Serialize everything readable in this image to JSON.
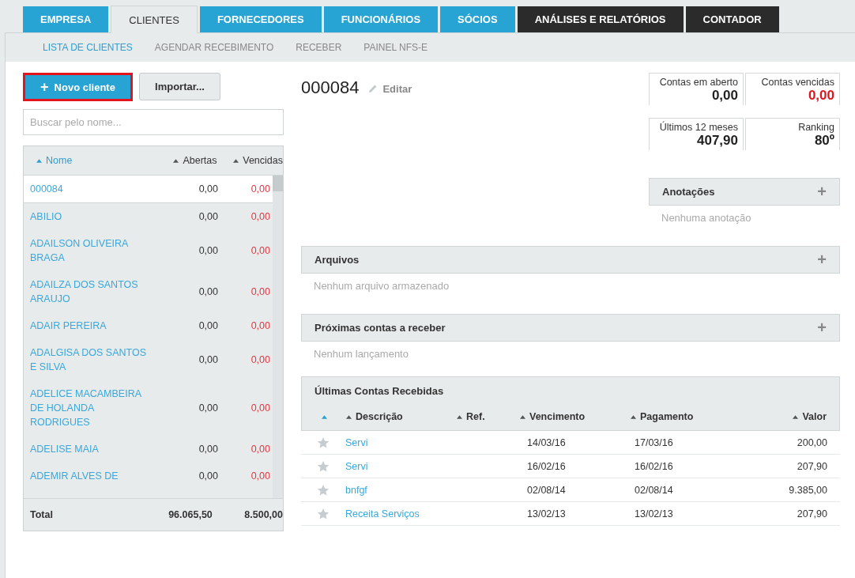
{
  "tabs": [
    {
      "label": "EMPRESA",
      "kind": "module",
      "selected": false
    },
    {
      "label": "CLIENTES",
      "kind": "module",
      "selected": true
    },
    {
      "label": "FORNECEDORES",
      "kind": "module",
      "selected": false
    },
    {
      "label": "FUNCIONÁRIOS",
      "kind": "module",
      "selected": false
    },
    {
      "label": "SÓCIOS",
      "kind": "module",
      "selected": false
    },
    {
      "label": "ANÁLISES E RELATÓRIOS",
      "kind": "report",
      "selected": false
    },
    {
      "label": "CONTADOR",
      "kind": "report",
      "selected": false
    }
  ],
  "subnav": [
    {
      "label": "LISTA DE CLIENTES",
      "selected": true
    },
    {
      "label": "AGENDAR RECEBIMENTO",
      "selected": false
    },
    {
      "label": "RECEBER",
      "selected": false
    },
    {
      "label": "PAINEL NFS-E",
      "selected": false
    }
  ],
  "new_button": {
    "icon": "+",
    "label": "Novo cliente"
  },
  "import_button": "Importar...",
  "search": {
    "placeholder": "Buscar pelo nome..."
  },
  "client_table": {
    "columns": [
      {
        "label": "Nome",
        "selected": true
      },
      {
        "label": "Abertas",
        "selected": false
      },
      {
        "label": "Vencidas",
        "selected": false
      }
    ],
    "rows": [
      {
        "name": "000084",
        "open": "0,00",
        "overdue": "0,00",
        "selected": true
      },
      {
        "name": "ABILIO",
        "open": "0,00",
        "overdue": "0,00",
        "selected": false
      },
      {
        "name": "ADAILSON OLIVEIRA BRAGA",
        "open": "0,00",
        "overdue": "0,00",
        "selected": false
      },
      {
        "name": "ADAILZA DOS SANTOS ARAUJO",
        "open": "0,00",
        "overdue": "0,00",
        "selected": false
      },
      {
        "name": "ADAIR PEREIRA",
        "open": "0,00",
        "overdue": "0,00",
        "selected": false
      },
      {
        "name": "ADALGISA DOS SANTOS E SILVA",
        "open": "0,00",
        "overdue": "0,00",
        "selected": false
      },
      {
        "name": "ADELICE MACAMBEIRA DE HOLANDA RODRIGUES",
        "open": "0,00",
        "overdue": "0,00",
        "selected": false
      },
      {
        "name": "ADELISE MAIA",
        "open": "0,00",
        "overdue": "0,00",
        "selected": false
      },
      {
        "name": "ADEMIR ALVES DE",
        "open": "0,00",
        "overdue": "0,00",
        "selected": false
      }
    ],
    "total": {
      "label": "Total",
      "open": "96.065,50",
      "overdue": "8.500,00"
    }
  },
  "client": {
    "code": "000084",
    "edit": "Editar"
  },
  "stats": [
    {
      "label": "Contas em aberto",
      "value": "0,00",
      "alert": false
    },
    {
      "label": "Contas vencidas",
      "value": "0,00",
      "alert": true
    },
    {
      "label": "Últimos 12 meses",
      "value": "407,90",
      "alert": false
    },
    {
      "label": "Ranking",
      "value": "80º",
      "alert": false
    }
  ],
  "notes": {
    "title": "Anotações",
    "add": "+",
    "empty": "Nenhuma anotação"
  },
  "sections": [
    {
      "title": "Arquivos",
      "add": "+",
      "empty": "Nenhum arquivo armazenado"
    },
    {
      "title": "Próximas contas a receber",
      "add": "+",
      "empty": "Nenhum lançamento"
    }
  ],
  "received": {
    "title": "Últimas Contas Recebidas",
    "columns": [
      {
        "selected": true
      },
      {
        "label": "Descrição",
        "selected": false
      },
      {
        "label": "Ref.",
        "selected": false
      },
      {
        "label": "Vencimento",
        "selected": false
      },
      {
        "label": "Pagamento",
        "selected": false
      },
      {
        "label": "Valor",
        "selected": false
      }
    ],
    "rows": [
      {
        "description": "Servi",
        "due": "14/03/16",
        "paid": "17/03/16",
        "value": "200,00"
      },
      {
        "description": "Servi",
        "due": "16/02/16",
        "paid": "16/02/16",
        "value": "207,90"
      },
      {
        "description": "bnfgf",
        "due": "02/08/14",
        "paid": "02/08/14",
        "value": "9.385,00"
      },
      {
        "description": "Receita Serviços",
        "due": "13/02/13",
        "paid": "13/02/13",
        "value": "207,90"
      }
    ]
  }
}
